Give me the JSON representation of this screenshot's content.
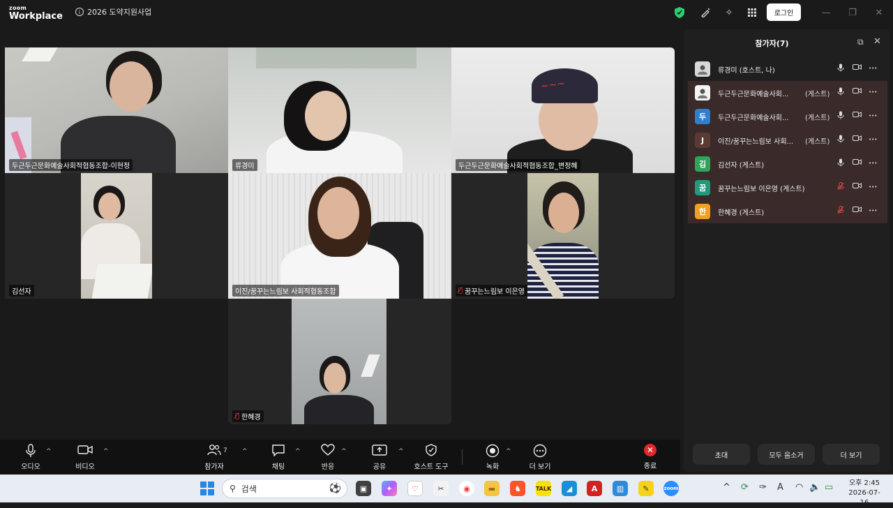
{
  "app": {
    "logo_top": "zoom",
    "logo_bottom": "Workplace",
    "meeting_title": "2026 도약지원사업",
    "login_label": "로그인"
  },
  "tiles": [
    {
      "name": "두근두근문화예술사회적협동조합-이현정",
      "muted": false,
      "active": true
    },
    {
      "name": "류경미",
      "muted": false,
      "active": false
    },
    {
      "name": "두근두근문화예술사회적협동조합_변정혜",
      "muted": false,
      "active": false
    },
    {
      "name": "김선자",
      "muted": false,
      "active": false
    },
    {
      "name": "이진/꿈꾸는느림보 사회적협동조합",
      "muted": false,
      "active": false
    },
    {
      "name": "꿈꾸는느림보 이은영",
      "muted": true,
      "active": false
    },
    {
      "name": "한혜경",
      "muted": true,
      "active": false
    }
  ],
  "toolbar": {
    "audio": "오디오",
    "video": "비디오",
    "participants": "참가자",
    "participants_count": "7",
    "chat": "채팅",
    "reactions": "반응",
    "share": "공유",
    "host_tools": "호스트 도구",
    "record": "녹화",
    "more": "더 보기",
    "end": "종료"
  },
  "panel": {
    "title": "참가자(7)",
    "participants": [
      {
        "name": "류경미 (호스트, 나)",
        "role": "",
        "avatar": "",
        "avatar_color": "#d8d8d8",
        "mic_muted": false,
        "guest": false
      },
      {
        "name": "두근두근문화예술사회...",
        "role": "(게스트)",
        "avatar": "",
        "avatar_color": "#f4f4f4",
        "mic_muted": false,
        "guest": true
      },
      {
        "name": "두근두근문화예술사회...",
        "role": "(게스트)",
        "avatar": "두",
        "avatar_color": "#2f7fd1",
        "mic_muted": false,
        "guest": true
      },
      {
        "name": "이진/꿈꾸는느림보 사회...",
        "role": "(게스트)",
        "avatar": "J",
        "avatar_color": "#5a3a32",
        "mic_muted": false,
        "guest": true
      },
      {
        "name": "김선자 (게스트)",
        "role": "",
        "avatar": "김",
        "avatar_color": "#2ea55a",
        "mic_muted": false,
        "guest": true
      },
      {
        "name": "꿈꾸는느림보 이은영 (게스트)",
        "role": "",
        "avatar": "꿈",
        "avatar_color": "#1f9b7a",
        "mic_muted": true,
        "guest": true
      },
      {
        "name": "한혜경 (게스트)",
        "role": "",
        "avatar": "한",
        "avatar_color": "#f0a020",
        "mic_muted": true,
        "guest": true
      }
    ],
    "invite": "초대",
    "mute_all": "모두 음소거",
    "more": "더 보기"
  },
  "taskbar": {
    "search_label": "검색",
    "time": "오후 2:45",
    "date": "2026-07-16"
  }
}
